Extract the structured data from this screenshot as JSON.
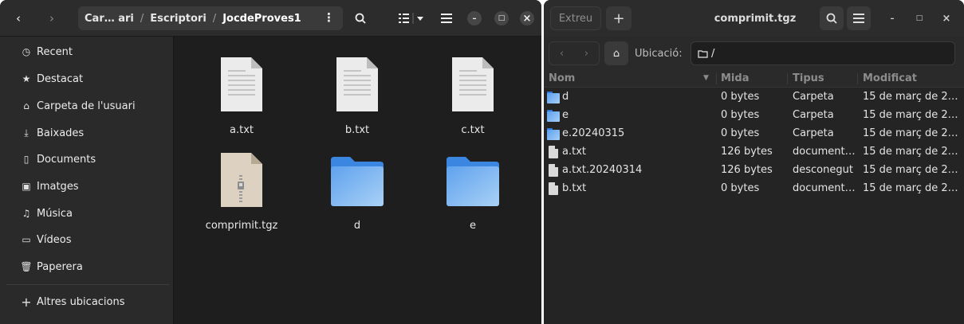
{
  "left_window": {
    "nav": {
      "back": "‹",
      "forward": "›"
    },
    "path": {
      "part1": "Car… ari",
      "sep1": "/",
      "part2": "Escriptori",
      "sep2": "/",
      "current": "JocdeProves1",
      "menu": "⋮"
    },
    "toolbar": {
      "search_icon": "search-icon",
      "view_icon": "list-view-icon",
      "menu_icon": "hamburger-icon"
    },
    "window_controls": {
      "minimize": "–",
      "maximize": "□",
      "close": "×"
    },
    "sidebar": {
      "items": [
        {
          "label": "Recent",
          "icon": "clock-icon",
          "glyph": "◷"
        },
        {
          "label": "Destacat",
          "icon": "star-icon",
          "glyph": "★"
        },
        {
          "label": "Carpeta de l'usuari",
          "icon": "home-icon",
          "glyph": "⌂"
        },
        {
          "label": "Baixades",
          "icon": "download-icon",
          "glyph": "⤓"
        },
        {
          "label": "Documents",
          "icon": "document-icon",
          "glyph": "▯"
        },
        {
          "label": "Imatges",
          "icon": "image-icon",
          "glyph": "▣"
        },
        {
          "label": "Música",
          "icon": "music-icon",
          "glyph": "♫"
        },
        {
          "label": "Vídeos",
          "icon": "video-icon",
          "glyph": "▭"
        },
        {
          "label": "Paperera",
          "icon": "trash-icon",
          "glyph": "🗑"
        }
      ],
      "other_locations": {
        "label": "Altres ubicacions",
        "glyph": "+"
      }
    },
    "files": [
      {
        "name": "a.txt",
        "type": "text"
      },
      {
        "name": "b.txt",
        "type": "text"
      },
      {
        "name": "c.txt",
        "type": "text"
      },
      {
        "name": "comprimit.tgz",
        "type": "archive"
      },
      {
        "name": "d",
        "type": "folder"
      },
      {
        "name": "e",
        "type": "folder"
      }
    ]
  },
  "right_window": {
    "extract_label": "Extreu",
    "add_label": "+",
    "title": "comprimit.tgz",
    "window_controls": {
      "minimize": "–",
      "maximize": "□",
      "close": "×"
    },
    "location": {
      "label": "Ubicació:",
      "path": "/"
    },
    "columns": {
      "name": "Nom",
      "size": "Mida",
      "type": "Tipus",
      "modified": "Modificat"
    },
    "rows": [
      {
        "name": "d",
        "size": "0 bytes",
        "type": "Carpeta",
        "modified": "15 de març de 2…",
        "icon": "folder"
      },
      {
        "name": "e",
        "size": "0 bytes",
        "type": "Carpeta",
        "modified": "15 de març de 2…",
        "icon": "folder"
      },
      {
        "name": "e.20240315",
        "size": "0 bytes",
        "type": "Carpeta",
        "modified": "15 de març de 2…",
        "icon": "folder"
      },
      {
        "name": "a.txt",
        "size": "126 bytes",
        "type": "document…",
        "modified": "15 de març de 2…",
        "icon": "document"
      },
      {
        "name": "a.txt.20240314",
        "size": "126 bytes",
        "type": "desconegut",
        "modified": "15 de març de 2…",
        "icon": "document"
      },
      {
        "name": "b.txt",
        "size": "0 bytes",
        "type": "document…",
        "modified": "15 de març de 2…",
        "icon": "document"
      }
    ]
  },
  "colors": {
    "folder_blue": "#4a90e2",
    "text_file": "#e8e8e8",
    "archive": "#d9cfc0"
  }
}
